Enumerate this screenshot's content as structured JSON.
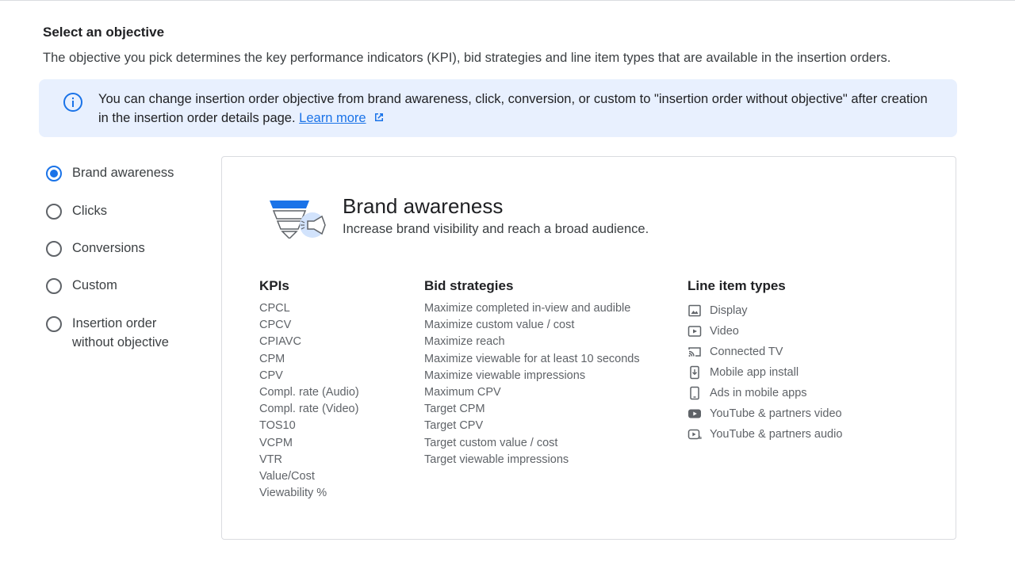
{
  "section": {
    "title": "Select an objective",
    "description": "The objective you pick determines the key performance indicators (KPI), bid strategies and line item types that are available in the insertion orders."
  },
  "info_banner": {
    "icon": "info-icon",
    "text": "You can change insertion order objective from brand awareness, click, conversion, or custom to \"insertion order without objective\" after creation in the insertion order details page.",
    "link_label": "Learn more",
    "link_icon": "open-in-new-icon"
  },
  "objectives": [
    {
      "label": "Brand awareness",
      "selected": true
    },
    {
      "label": "Clicks",
      "selected": false
    },
    {
      "label": "Conversions",
      "selected": false
    },
    {
      "label": "Custom",
      "selected": false
    },
    {
      "label": "Insertion order without objective",
      "selected": false
    }
  ],
  "detail": {
    "icon": "funnel-megaphone-icon",
    "title": "Brand awareness",
    "subtitle": "Increase brand visibility and reach a broad audience.",
    "kpis": {
      "title": "KPIs",
      "items": [
        "CPCL",
        "CPCV",
        "CPIAVC",
        "CPM",
        "CPV",
        "Compl. rate (Audio)",
        "Compl. rate (Video)",
        "TOS10",
        "VCPM",
        "VTR",
        "Value/Cost",
        "Viewability %"
      ]
    },
    "bid_strategies": {
      "title": "Bid strategies",
      "items": [
        "Maximize completed in-view and audible",
        "Maximize custom value / cost",
        "Maximize reach",
        "Maximize viewable for at least 10 seconds",
        "Maximize viewable impressions",
        "Maximum CPV",
        "Target CPM",
        "Target CPV",
        "Target custom value / cost",
        "Target viewable impressions"
      ]
    },
    "line_item_types": {
      "title": "Line item types",
      "items": [
        {
          "label": "Display",
          "icon": "image-icon"
        },
        {
          "label": "Video",
          "icon": "video-icon"
        },
        {
          "label": "Connected TV",
          "icon": "cast-icon"
        },
        {
          "label": "Mobile app install",
          "icon": "app-install-icon"
        },
        {
          "label": "Ads in mobile apps",
          "icon": "phone-icon"
        },
        {
          "label": "YouTube & partners video",
          "icon": "youtube-icon"
        },
        {
          "label": "YouTube & partners audio",
          "icon": "youtube-audio-icon"
        }
      ]
    }
  },
  "colors": {
    "accent": "#1a73e8",
    "banner_bg": "#e8f0fe",
    "text_primary": "#202124",
    "text_secondary": "#5f6368"
  }
}
